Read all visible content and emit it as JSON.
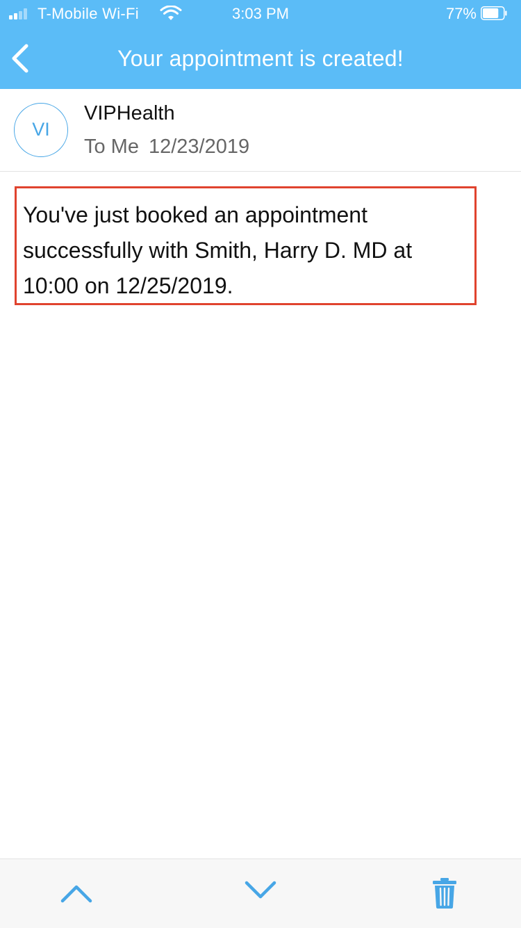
{
  "status_bar": {
    "carrier": "T-Mobile Wi-Fi",
    "time": "3:03 PM",
    "battery_percent": "77%",
    "battery_level": 0.77,
    "icons": [
      "signal-icon",
      "wifi-icon",
      "battery-icon"
    ]
  },
  "nav": {
    "title": "Your appointment is created!",
    "back_icon": "chevron-left-icon"
  },
  "message": {
    "avatar_initials": "VI",
    "sender": "VIPHealth",
    "recipient": "To Me",
    "date": "12/23/2019",
    "body": "You've just booked an appointment successfully with Smith, Harry D.  MD at 10:00 on 12/25/2019."
  },
  "toolbar": {
    "icons": [
      "chevron-up-icon",
      "chevron-down-icon",
      "trash-icon"
    ]
  },
  "colors": {
    "header_blue": "#5bbcf7",
    "accent_blue": "#47a6e6",
    "highlight_red": "#e0432e",
    "toolbar_bg": "#f7f7f7"
  }
}
